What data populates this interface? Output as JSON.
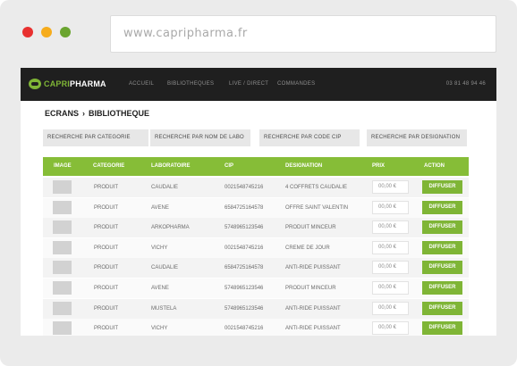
{
  "window": {
    "dot_colors": [
      "#e8302f",
      "#f6ac1c",
      "#6aa42f"
    ],
    "address": "www.capripharma.fr"
  },
  "nav": {
    "logo_part1": "CAPRI",
    "logo_part2": "PHARMA",
    "items": [
      "ACCUEIL",
      "BIBLIOTHEQUES",
      "LIVE / DIRECT",
      "COMMANDES"
    ],
    "phone": "03 81 48 94 46"
  },
  "breadcrumb": {
    "first": "ECRANS",
    "separator": "›",
    "current": "BIBLIOTHEQUE"
  },
  "filters": [
    "RECHERCHE PAR CATEGORIE",
    "RECHERCHE PAR NOM DE LABO",
    "RECHERCHE PAR CODE CIP",
    "RECHERCHE PAR DESIGNATION"
  ],
  "table": {
    "headers": [
      "IMAGE",
      "CATEGORIE",
      "LABORATOIRE",
      "CIP",
      "DESIGNATION",
      "PRIX",
      "ACTION"
    ],
    "rows": [
      {
        "categorie": "PRODUIT",
        "labo": "CAUDALIE",
        "cip": "0021548745216",
        "designation": "4 COFFRETS CAUDALIE",
        "prix": "00,00 €",
        "action": "DIFFUSER"
      },
      {
        "categorie": "PRODUIT",
        "labo": "AVENE",
        "cip": "6584725164578",
        "designation": "OFFRE SAINT VALENTIN",
        "prix": "00,00 €",
        "action": "DIFFUSER"
      },
      {
        "categorie": "PRODUIT",
        "labo": "ARKOPHARMA",
        "cip": "5748965123546",
        "designation": "PRODUIT MINCEUR",
        "prix": "00,00 €",
        "action": "DIFFUSER"
      },
      {
        "categorie": "PRODUIT",
        "labo": "VICHY",
        "cip": "0021548745216",
        "designation": "CREME DE JOUR",
        "prix": "00,00 €",
        "action": "DIFFUSER"
      },
      {
        "categorie": "PRODUIT",
        "labo": "CAUDALIE",
        "cip": "6584725164578",
        "designation": "ANTI-RIDE PUISSANT",
        "prix": "00,00 €",
        "action": "DIFFUSER"
      },
      {
        "categorie": "PRODUIT",
        "labo": "AVENE",
        "cip": "5748965123546",
        "designation": "PRODUIT MINCEUR",
        "prix": "00,00 €",
        "action": "DIFFUSER"
      },
      {
        "categorie": "PRODUIT",
        "labo": "MUSTELA",
        "cip": "5748965123546",
        "designation": "ANTI-RIDE PUISSANT",
        "prix": "00,00 €",
        "action": "DIFFUSER"
      },
      {
        "categorie": "PRODUIT",
        "labo": "VICHY",
        "cip": "0021548745216",
        "designation": "ANTI-RIDE PUISSANT",
        "prix": "00,00 €",
        "action": "DIFFUSER"
      }
    ]
  },
  "colors": {
    "accent": "#86bd37",
    "button": "#7fb536",
    "navbar": "#1f1f1f"
  }
}
